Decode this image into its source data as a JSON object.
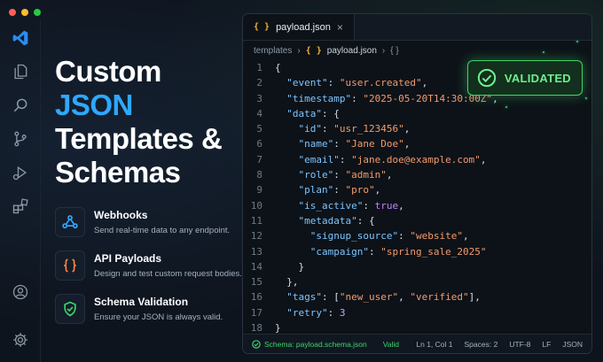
{
  "hero": {
    "line1": "Custom",
    "line2": "JSON",
    "line3": "Templates &",
    "line4": "Schemas"
  },
  "features": [
    {
      "icon": "webhook-icon",
      "title": "Webhooks",
      "desc": "Send real-time data to any endpoint."
    },
    {
      "icon": "braces-icon",
      "title": "API Payloads",
      "desc": "Design and test custom request bodies."
    },
    {
      "icon": "shield-check-icon",
      "title": "Schema Validation",
      "desc": "Ensure your JSON is always valid."
    }
  ],
  "editor": {
    "tab_icon": "{ }",
    "tab_label": "payload.json",
    "tab_close": "×",
    "breadcrumb": {
      "folder": "templates",
      "sep": "›",
      "file_icon": "{ }",
      "file": "payload.json",
      "tail_icon": "{ }"
    },
    "badge": "VALIDATED",
    "lines": [
      "1",
      "2",
      "3",
      "4",
      "5",
      "6",
      "7",
      "8",
      "9",
      "10",
      "11",
      "12",
      "13",
      "14",
      "15",
      "16",
      "17",
      "18"
    ],
    "status": {
      "schema": "Schema: payload.schema.json",
      "valid": "Valid",
      "position": "Ln 1, Col 1",
      "spaces": "Spaces: 2",
      "encoding": "UTF-8",
      "eol": "LF",
      "language": "JSON"
    }
  },
  "code": {
    "event_key": "\"event\"",
    "event_val": "\"user.created\"",
    "timestamp_key": "\"timestamp\"",
    "timestamp_val": "\"2025-05-20T14:30:00Z\"",
    "data_key": "\"data\"",
    "id_key": "\"id\"",
    "id_val": "\"usr_123456\"",
    "name_key": "\"name\"",
    "name_val": "\"Jane Doe\"",
    "email_key": "\"email\"",
    "email_val": "\"jane.doe@example.com\"",
    "role_key": "\"role\"",
    "role_val": "\"admin\"",
    "plan_key": "\"plan\"",
    "plan_val": "\"pro\"",
    "active_key": "\"is_active\"",
    "active_val": "true",
    "metadata_key": "\"metadata\"",
    "signup_key": "\"signup_source\"",
    "signup_val": "\"website\"",
    "campaign_key": "\"campaign\"",
    "campaign_val": "\"spring_sale_2025\"",
    "tags_key": "\"tags\"",
    "tag1": "\"new_user\"",
    "tag2": "\"verified\"",
    "retry_key": "\"retry\"",
    "retry_val": "3"
  },
  "colors": {
    "accent": "#2ea8ff",
    "success": "#3fd46a",
    "string": "#f29b6b",
    "key": "#7cc4ff"
  }
}
